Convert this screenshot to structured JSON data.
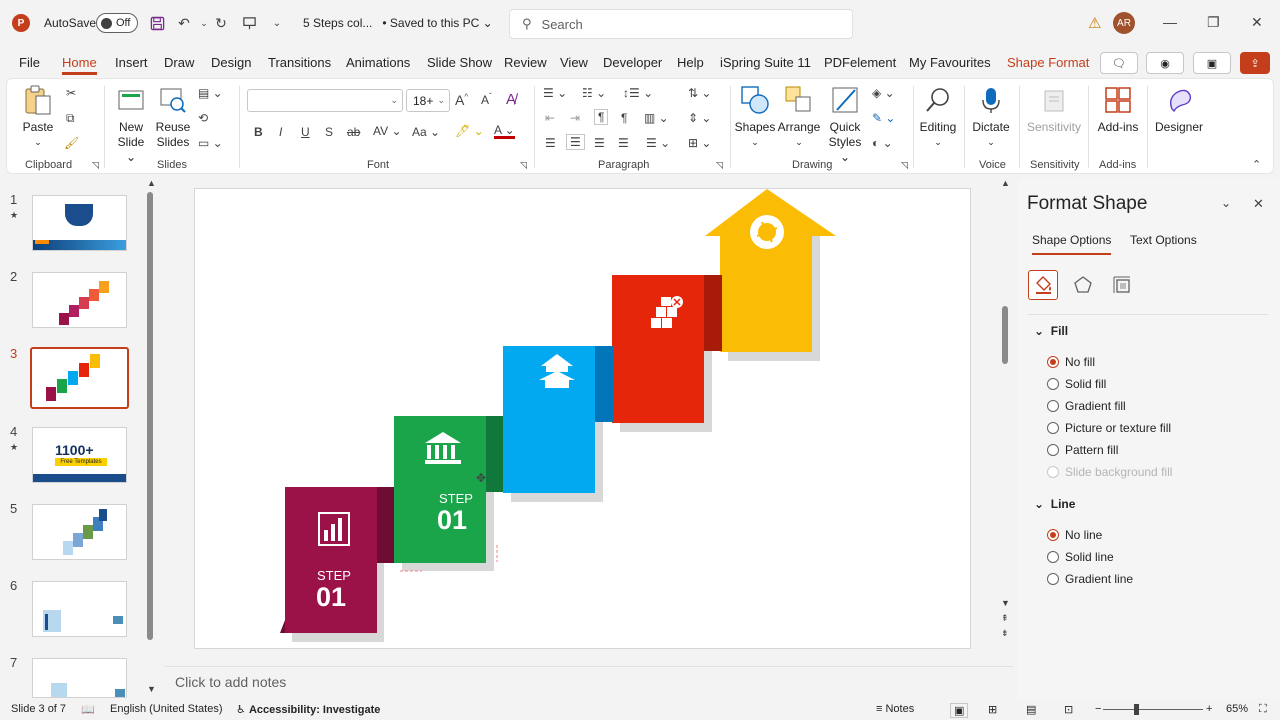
{
  "titlebar": {
    "app_logo": "P",
    "autosave_label": "AutoSave",
    "autosave_state": "Off",
    "document_title": "5 Steps col...",
    "save_status": "• Saved to this PC",
    "search_placeholder": "Search",
    "avatar_initials": "AR"
  },
  "menu": {
    "items": [
      "File",
      "Home",
      "Insert",
      "Draw",
      "Design",
      "Transitions",
      "Animations",
      "Slide Show",
      "Review",
      "View",
      "Developer",
      "Help",
      "iSpring Suite 11",
      "PDFelement",
      "My Favourites",
      "Shape Format"
    ]
  },
  "ribbon": {
    "clipboard": {
      "paste": "Paste",
      "label": "Clipboard"
    },
    "slides": {
      "new_slide_1": "New",
      "new_slide_2": "Slide",
      "reuse_1": "Reuse",
      "reuse_2": "Slides",
      "label": "Slides"
    },
    "font": {
      "font_name": "",
      "font_size": "18+",
      "label": "Font"
    },
    "paragraph": {
      "label": "Paragraph"
    },
    "drawing": {
      "shapes": "Shapes",
      "arrange": "Arrange",
      "quick_styles_1": "Quick",
      "quick_styles_2": "Styles",
      "label": "Drawing"
    },
    "editing": {
      "label": "Editing"
    },
    "voice": {
      "dictate": "Dictate",
      "label": "Voice"
    },
    "sensitivity": {
      "button": "Sensitivity",
      "label": "Sensitivity"
    },
    "addins": {
      "button": "Add-ins",
      "label": "Add-ins"
    },
    "designer": {
      "button": "Designer"
    }
  },
  "thumbnails": [
    {
      "num": "1",
      "star": "★"
    },
    {
      "num": "2",
      "star": ""
    },
    {
      "num": "3",
      "star": ""
    },
    {
      "num": "4",
      "star": "★"
    },
    {
      "num": "5",
      "star": ""
    },
    {
      "num": "6",
      "star": ""
    },
    {
      "num": "7",
      "star": ""
    }
  ],
  "thumb4_text": {
    "big": "1100+",
    "sub": "Free Templates"
  },
  "slide": {
    "step1_label": "STEP",
    "step1_num": "01",
    "step2_label": "STEP",
    "step2_num": "01"
  },
  "notes_placeholder": "Click to add notes",
  "format_pane": {
    "title": "Format Shape",
    "tabs": [
      "Shape Options",
      "Text Options"
    ],
    "fill_header": "Fill",
    "fill_options": [
      {
        "label": "No fill",
        "checked": true,
        "disabled": false
      },
      {
        "label": "Solid fill",
        "checked": false,
        "disabled": false
      },
      {
        "label": "Gradient fill",
        "checked": false,
        "disabled": false
      },
      {
        "label": "Picture or texture fill",
        "checked": false,
        "disabled": false
      },
      {
        "label": "Pattern fill",
        "checked": false,
        "disabled": false
      },
      {
        "label": "Slide background fill",
        "checked": false,
        "disabled": true
      }
    ],
    "line_header": "Line",
    "line_options": [
      {
        "label": "No line",
        "checked": true
      },
      {
        "label": "Solid line",
        "checked": false
      },
      {
        "label": "Gradient line",
        "checked": false
      }
    ]
  },
  "statusbar": {
    "slide_count": "Slide 3 of 7",
    "language": "English (United States)",
    "accessibility": "Accessibility: Investigate",
    "notes": "Notes",
    "zoom": "65%"
  },
  "colors": {
    "accent": "#c43e1c",
    "step_maroon": "#9b1248",
    "step_green": "#1aa54b",
    "step_blue": "#03a9f0",
    "step_red": "#e5260a",
    "step_yellow": "#fbbc06"
  }
}
